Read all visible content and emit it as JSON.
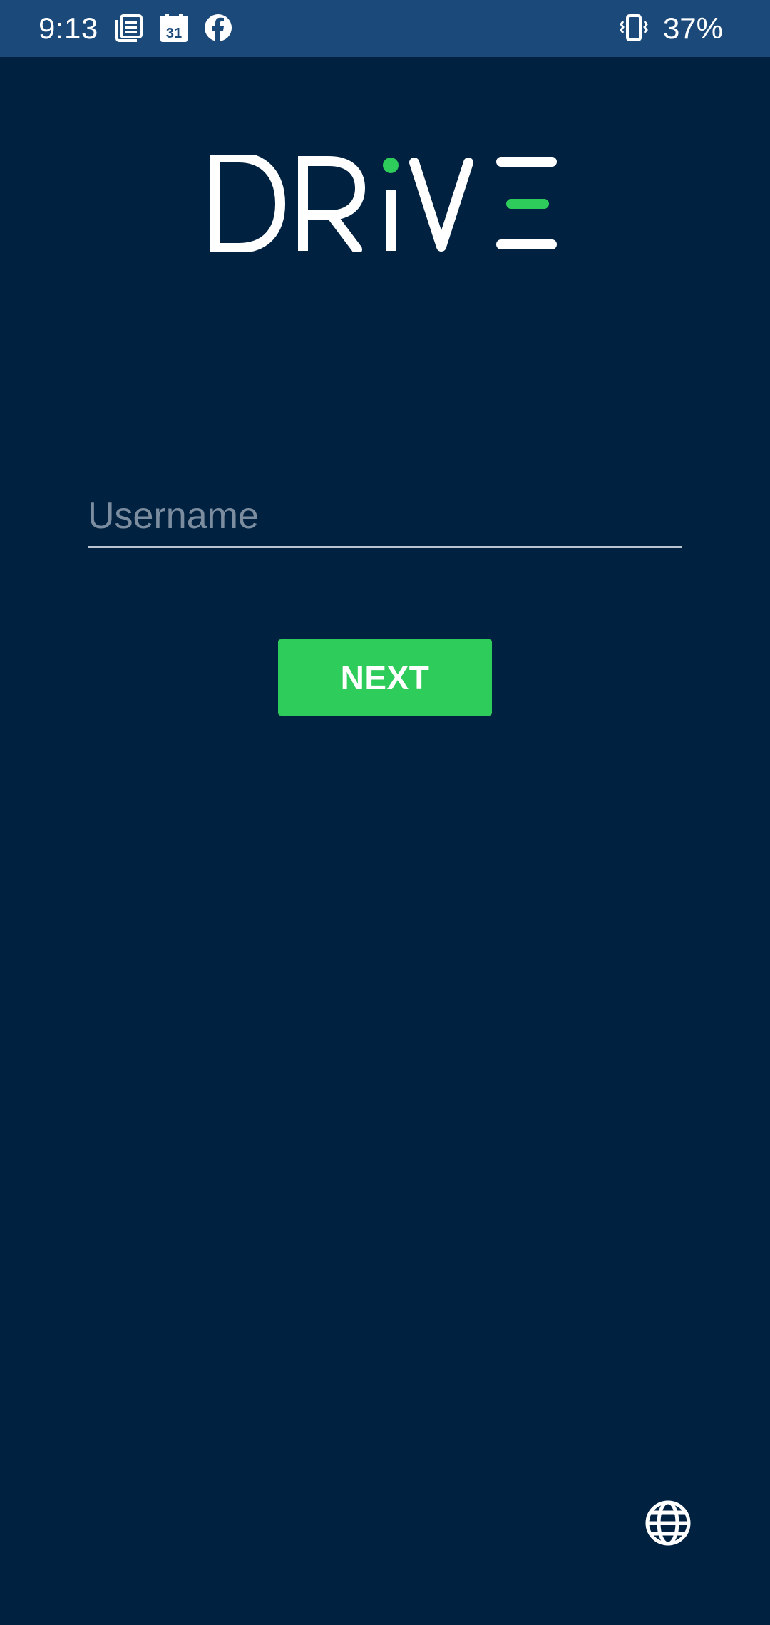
{
  "status_bar": {
    "time": "9:13",
    "notification_icons": [
      "news-icon",
      "calendar-icon",
      "facebook-icon"
    ],
    "calendar_day": "31",
    "vibrate_icon": "vibrate-icon",
    "battery": "37%"
  },
  "logo": {
    "text": "DRiVE",
    "accent_color": "#2ecc5b"
  },
  "login": {
    "username_placeholder": "Username",
    "username_value": "",
    "next_label": "NEXT"
  },
  "footer": {
    "language_icon": "globe-icon"
  },
  "colors": {
    "background": "#002140",
    "status_bar": "#1b4a7a",
    "button": "#2ecc5b",
    "placeholder": "#7c8d9f"
  }
}
